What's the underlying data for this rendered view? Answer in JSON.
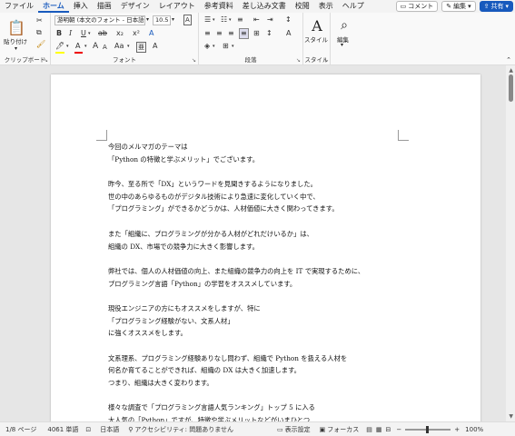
{
  "tabs": [
    "ファイル",
    "ホーム",
    "挿入",
    "描画",
    "デザイン",
    "レイアウト",
    "参考資料",
    "差し込み文書",
    "校閲",
    "表示",
    "ヘルプ"
  ],
  "active_tab": "ホーム",
  "right_buttons": {
    "comment": "コメント",
    "edit": "編集",
    "share": "共有"
  },
  "ribbon": {
    "paste": "貼り付け",
    "clipboard": "クリップボード",
    "font_name": "游明朝 (本文のフォント - 日本語",
    "font_size": "10.5",
    "font": "フォント",
    "paragraph": "段落",
    "styles_btn": "スタイル",
    "styles": "スタイル",
    "edit_btn": "編集"
  },
  "document": {
    "lines": [
      "今回のメルマガのテーマは",
      "「Python の特徴と学ぶメリット」でございます。",
      "",
      "昨今、至る所で「DX」というワードを見聞きするようになりました。",
      "世の中のあらゆるものがデジタル技術により急速に変化していく中で、",
      "「プログラミング」ができるかどうかは、人材価値に大きく関わってきます。",
      "",
      "また「組織に、プログラミングが分かる人材がどれだけいるか」は、",
      "組織の DX、市場での競争力に大きく影響します。",
      "",
      "弊社では、個人の人材価値の向上、また組織の競争力の向上を IT で実現するために、",
      "プログラミング言語「Python」の学習をオススメしています。",
      "",
      "現役エンジニアの方にもオススメをしますが、特に",
      "「プログラミング経験がない、文系人材」",
      "に強くオススメをします。",
      "",
      "文系理系、プログラミング経験ありなし問わず、組織で Python を扱える人材を",
      "何名か育てることができれば、組織の DX は大きく加速します。",
      "つまり、組織は大きく変わります。",
      "",
      "様々な調査で「プログラミング言語人気ランキング」トップ 5 に入る",
      "大人気の「Python」ですが、特徴や学ぶメリットなどがいまひとつ"
    ]
  },
  "status": {
    "page": "1/8 ページ",
    "words": "4061 単語",
    "language": "日本語",
    "accessibility": "アクセシビリティ: 問題ありません",
    "display_settings": "表示設定",
    "focus": "フォーカス",
    "zoom": "100%"
  }
}
